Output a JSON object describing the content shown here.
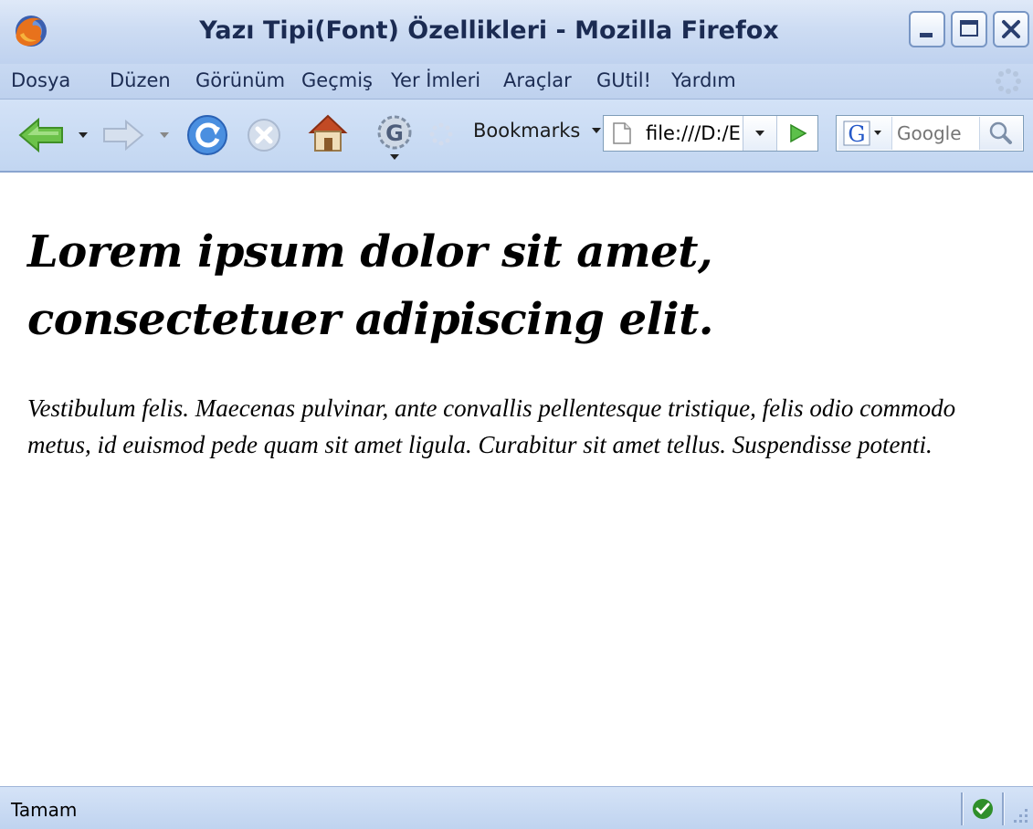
{
  "window": {
    "title": "Yazı Tipi(Font) Özellikleri - Mozilla Firefox"
  },
  "menu": {
    "items": [
      "Dosya",
      "Düzen",
      "Görünüm",
      "Geçmiş",
      "Yer İmleri",
      "Araçlar",
      "GUtil!",
      "Yardım"
    ]
  },
  "toolbar": {
    "bookmarks_label": "Bookmarks",
    "url": "file:///D:/E",
    "search_placeholder": "Google",
    "search_engine_icon": "google-g-icon"
  },
  "content": {
    "heading": "Lorem ipsum dolor sit amet, consectetuer adipiscing elit.",
    "paragraph": "Vestibulum felis. Maecenas pulvinar, ante convallis pellentesque tristique, felis odio commodo metus, id euismod pede quam sit amet ligula. Curabitur sit amet tellus. Suspendisse potenti."
  },
  "status": {
    "text": "Tamam"
  },
  "colors": {
    "title_text": "#1b2b52",
    "search_placeholder": "#5b8cd9"
  }
}
